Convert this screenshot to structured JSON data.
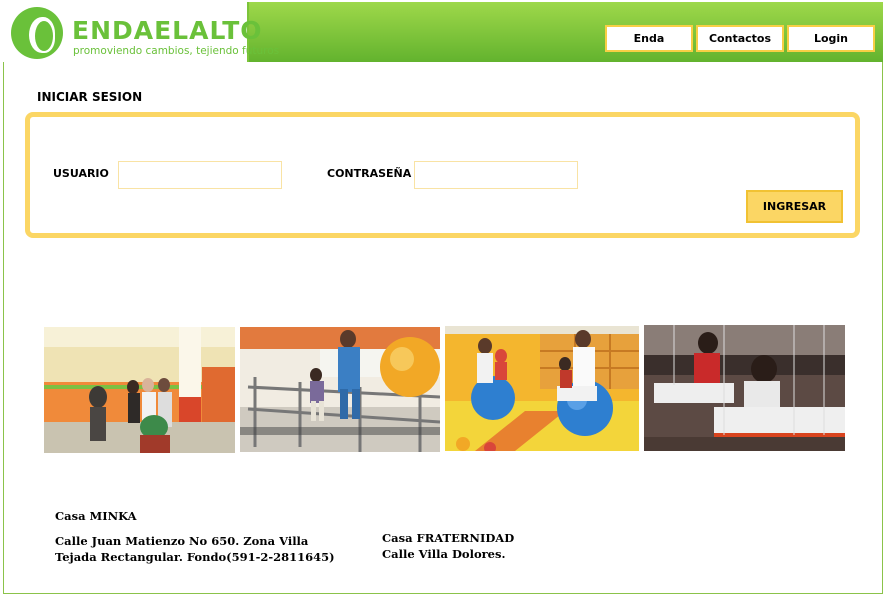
{
  "brand": {
    "name": "ENDAELALTO",
    "tagline": "promoviendo cambios, tejiendo futuros",
    "logo_icon": "face-profile-icon",
    "colors": {
      "green": "#6ac13a",
      "yellow": "#fbd664"
    }
  },
  "nav": {
    "items": [
      {
        "label": "Enda"
      },
      {
        "label": "Contactos"
      },
      {
        "label": "Login"
      }
    ]
  },
  "login": {
    "title": "INICIAR SESION",
    "user_label": "USUARIO",
    "user_value": "",
    "password_label": "CONTRASEÑA",
    "password_value": "",
    "submit_label": "INGRESAR"
  },
  "gallery": [
    {
      "name": "photo-visit"
    },
    {
      "name": "photo-therapy-bars"
    },
    {
      "name": "photo-therapy-balls"
    },
    {
      "name": "photo-weaving"
    }
  ],
  "locations": [
    {
      "name": "Casa MINKA",
      "address": "Calle Juan Matienzo No 650. Zona Villa Tejada Rectangular. Fondo(591-2-2811645)"
    },
    {
      "name": "Casa FRATERNIDAD",
      "address": "Calle Villa Dolores."
    }
  ]
}
